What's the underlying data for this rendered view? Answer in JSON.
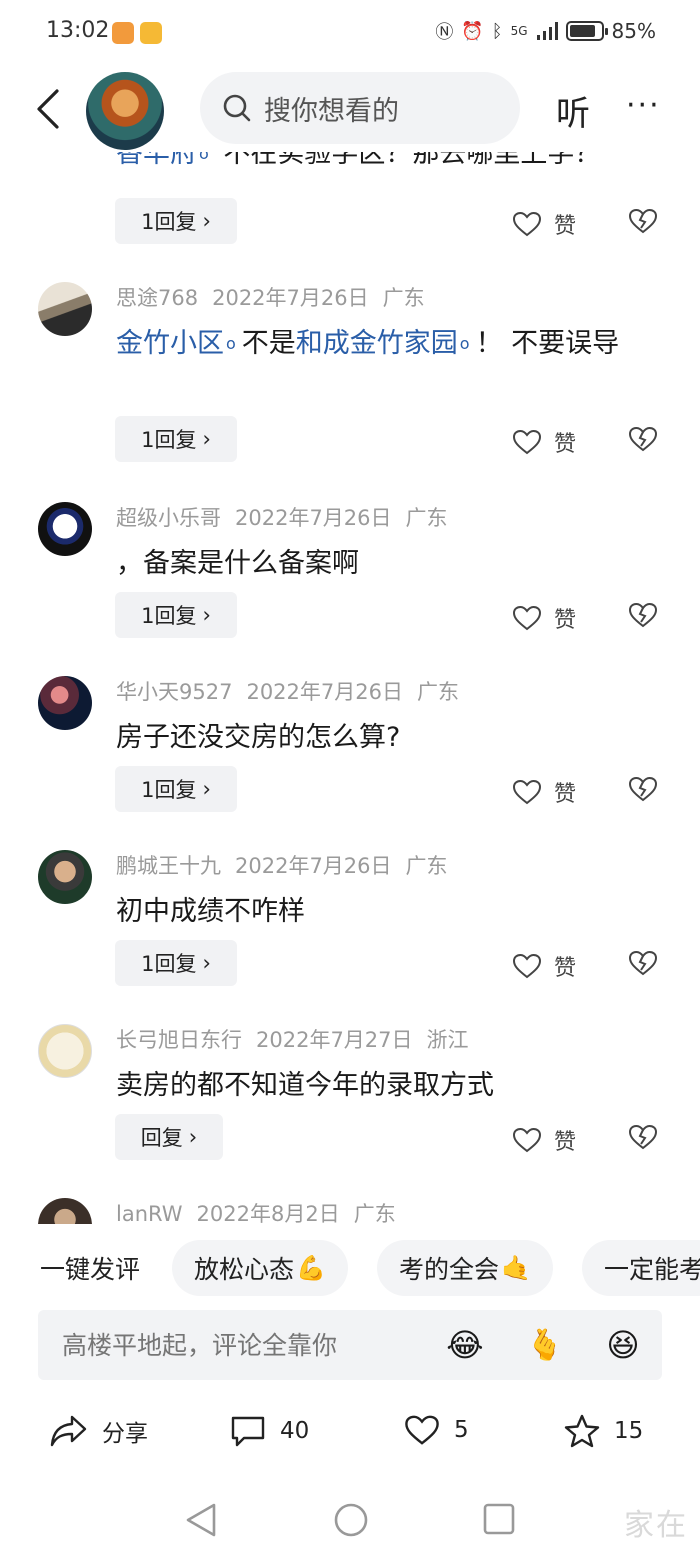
{
  "status_bar": {
    "time": "13:02",
    "network": "5G",
    "battery_percent": "85%",
    "battery_level": 0.85
  },
  "header": {
    "search_placeholder": "搜你想看的",
    "listen_label": "听",
    "more_label": "···"
  },
  "partial_comment": {
    "text_link": "香华府",
    "text_rest": "不在实验学区？那去哪里上学？",
    "reply_label": "1回复",
    "like_label": "赞"
  },
  "comments": [
    {
      "user": "思途768",
      "date": "2022年7月26日",
      "location": "广东",
      "link1": "金竹小区",
      "mid": "不是",
      "link2": "和成金竹家园",
      "rest": "！ 不要误导",
      "reply_label": "1回复",
      "like_label": "赞"
    },
    {
      "user": "超级小乐哥",
      "date": "2022年7月26日",
      "location": "广东",
      "text": "，备案是什么备案啊",
      "reply_label": "1回复",
      "like_label": "赞"
    },
    {
      "user": "华小天9527",
      "date": "2022年7月26日",
      "location": "广东",
      "text": "房子还没交房的怎么算?",
      "reply_label": "1回复",
      "like_label": "赞"
    },
    {
      "user": "鹏城王十九",
      "date": "2022年7月26日",
      "location": "广东",
      "text": "初中成绩不咋样",
      "reply_label": "1回复",
      "like_label": "赞"
    },
    {
      "user": "长弓旭日东行",
      "date": "2022年7月27日",
      "location": "浙江",
      "text": "卖房的都不知道今年的录取方式",
      "reply_label": "回复",
      "like_label": "赞"
    },
    {
      "user": "lanRW",
      "date": "2022年8月2日",
      "location": "广东"
    }
  ],
  "quick_comments": [
    {
      "label": "一键发评",
      "emoji": ""
    },
    {
      "label": "放松心态",
      "emoji": "💪"
    },
    {
      "label": "考的全会",
      "emoji": "🤙"
    },
    {
      "label": "一定能考",
      "emoji": ""
    }
  ],
  "comment_input": {
    "placeholder": "高楼平地起，评论全靠你",
    "emojis": [
      "😂",
      "🫰",
      "😆"
    ]
  },
  "actions": {
    "share_label": "分享",
    "comment_count": "40",
    "like_count": "5",
    "favorite_count": "15"
  },
  "watermark": "家在"
}
